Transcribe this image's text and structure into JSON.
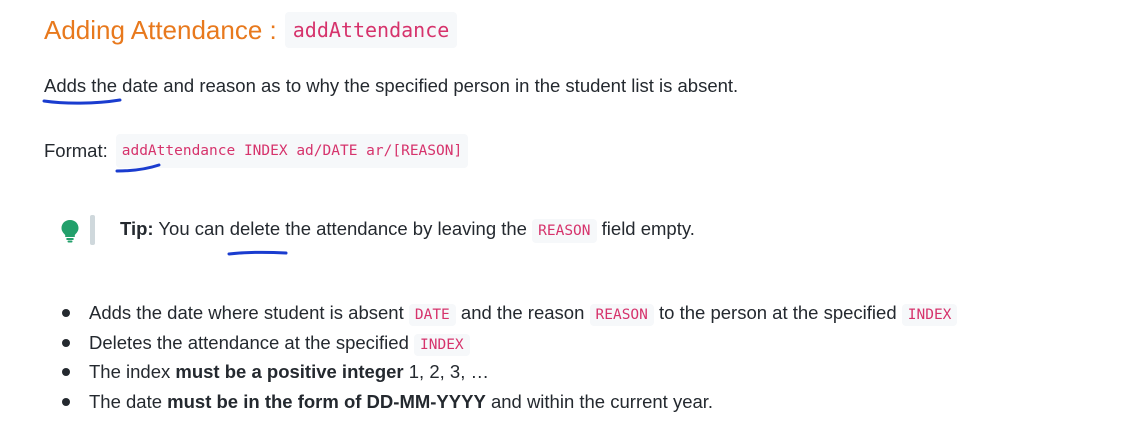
{
  "heading": {
    "title": "Adding Attendance :",
    "command": "addAttendance"
  },
  "description": "Adds the date and reason as to why the specified person in the student list is absent.",
  "format": {
    "label": "Format:",
    "syntax": "addAttendance INDEX ad/DATE ar/[REASON]"
  },
  "tip": {
    "icon": "lightbulb-icon",
    "label": "Tip:",
    "text_before": "You can delete the attendance by leaving the",
    "code": "REASON",
    "text_after": "field empty."
  },
  "bullets": [
    {
      "t1": "Adds the date where student is absent",
      "c1": "DATE",
      "t2": "and the reason",
      "c2": "REASON",
      "t3": "to the person at the specified",
      "c3": "INDEX"
    },
    {
      "t1": "Deletes the attendance at the specified",
      "c1": "INDEX"
    },
    {
      "t1": "The index",
      "bold": "must be a positive integer",
      "t2": "1, 2, 3, …"
    },
    {
      "t1": "The date",
      "bold": "must be in the form of DD-MM-YYYY",
      "t2": "and within the current year."
    }
  ],
  "colors": {
    "heading": "#e8791d",
    "code_text": "#d6336c",
    "code_bg": "#f6f8fa",
    "annotation": "#1a3ccf",
    "tip_icon": "#22a06b"
  }
}
